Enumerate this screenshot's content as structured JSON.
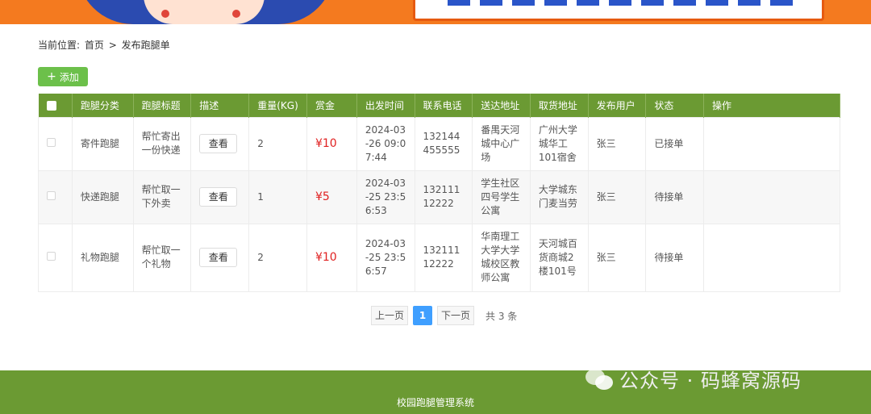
{
  "breadcrumb": {
    "prefix": "当前位置:",
    "home": "首页",
    "sep": ">",
    "current": "发布跑腿单"
  },
  "toolbar": {
    "add_icon": "+",
    "add_label": "添加"
  },
  "table": {
    "headers": [
      "跑腿分类",
      "跑腿标题",
      "描述",
      "重量(KG)",
      "赏金",
      "出发时间",
      "联系电话",
      "送达地址",
      "取货地址",
      "发布用户",
      "状态",
      "操作"
    ],
    "rows": [
      {
        "category": "寄件跑腿",
        "title": "帮忙寄出一份快递",
        "desc_btn": "查看",
        "weight": "2",
        "reward": "¥10",
        "time": "2024-03-26 09:07:44",
        "phone": "132144455555",
        "to": "番禺天河城中心广场",
        "from": "广州大学城华工101宿舍",
        "user": "张三",
        "status": "已接单",
        "op": ""
      },
      {
        "category": "快递跑腿",
        "title": "帮忙取一下外卖",
        "desc_btn": "查看",
        "weight": "1",
        "reward": "¥5",
        "time": "2024-03-25 23:56:53",
        "phone": "13211112222",
        "to": "学生社区四号学生公寓",
        "from": "大学城东门麦当劳",
        "user": "张三",
        "status": "待接单",
        "op": ""
      },
      {
        "category": "礼物跑腿",
        "title": "帮忙取一个礼物",
        "desc_btn": "查看",
        "weight": "2",
        "reward": "¥10",
        "time": "2024-03-25 23:56:57",
        "phone": "13211112222",
        "to": "华南理工大学大学城校区教师公寓",
        "from": "天河城百货商城2楼101号",
        "user": "张三",
        "status": "待接单",
        "op": ""
      }
    ]
  },
  "pagination": {
    "prev": "上一页",
    "current": "1",
    "next": "下一页",
    "total": "共 3 条"
  },
  "footer": {
    "title": "校园跑腿管理系统"
  },
  "watermark": {
    "text": "公众号 · 码蜂窝源码"
  },
  "colors": {
    "primary_green": "#6b9a33",
    "add_green": "#6cc04a",
    "price_red": "#e02020",
    "page_blue": "#3f9fff"
  }
}
